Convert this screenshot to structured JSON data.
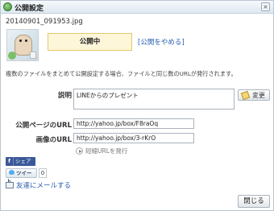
{
  "window": {
    "title": "公開設定",
    "close_glyph": "×"
  },
  "file": {
    "name": "20140901_091953.jpg"
  },
  "status": {
    "label": "公開中",
    "stop_link": "[公開をやめる]"
  },
  "description": "複数のファイルをまとめて公開設定する場合、ファイルと同じ数のURLが発行されます。",
  "caption": {
    "label": "説明",
    "value": "LINEからのプレゼント",
    "change_button": "変更"
  },
  "page_url": {
    "label": "公開ページのURL",
    "value": "http://yahoo.jp/box/F8raOq"
  },
  "image_url": {
    "label": "画像のURL",
    "value": "http://yahoo.jp/box/3-rKrO"
  },
  "shorten": {
    "label": "短縮URLを発行"
  },
  "share": {
    "facebook": {
      "icon": "f",
      "label": "シェア"
    },
    "twitter": {
      "label": "ツイート",
      "count": "0"
    },
    "mail": {
      "label": "友達にメールする"
    }
  },
  "footer": {
    "close_button": "閉じる"
  },
  "colors": {
    "accent_link": "#2a5db0",
    "status_bg": "#fdf6d8",
    "status_border": "#e6c86a",
    "facebook": "#3b5998"
  }
}
